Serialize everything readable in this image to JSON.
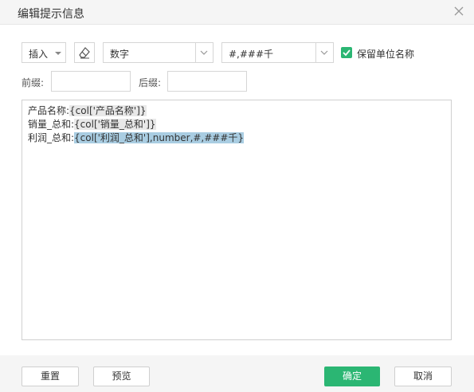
{
  "dialog": {
    "title": "编辑提示信息",
    "close_icon": "close-icon"
  },
  "toolbar": {
    "insert_label": "插入",
    "eraser_icon": "eraser-icon",
    "type_value": "数字",
    "format_value": "#,###千",
    "keep_unit_label": "保留单位名称",
    "keep_unit_checked": true
  },
  "affix": {
    "prefix_label": "前缀:",
    "prefix_value": "",
    "suffix_label": "后缀:",
    "suffix_value": ""
  },
  "editor": {
    "lines": [
      {
        "label": "产品名称:",
        "token": "{col['产品名称']}"
      },
      {
        "label": "销量_总和:",
        "token": "{col['销量_总和']}"
      },
      {
        "label": "利润_总和:",
        "token": "{col['利润_总和'],number,#,###千}"
      }
    ]
  },
  "footer": {
    "reset_label": "重置",
    "preview_label": "预览",
    "ok_label": "确定",
    "cancel_label": "取消"
  },
  "colors": {
    "accent": "#2bb673",
    "selection": "#a9cde2",
    "token_bg": "#e8e8e8"
  }
}
